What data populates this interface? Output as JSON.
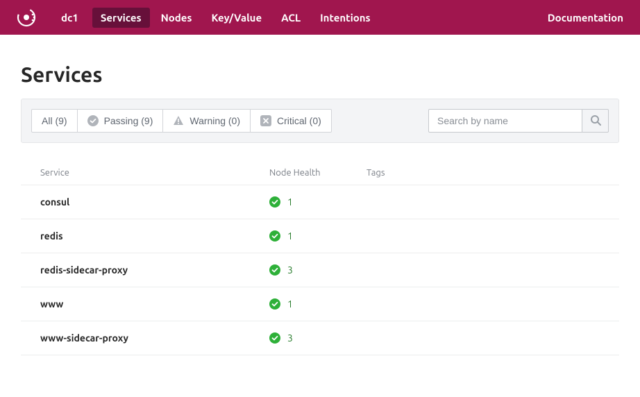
{
  "nav": {
    "datacenter": "dc1",
    "items": [
      {
        "label": "Services",
        "active": true
      },
      {
        "label": "Nodes",
        "active": false
      },
      {
        "label": "Key/Value",
        "active": false
      },
      {
        "label": "ACL",
        "active": false
      },
      {
        "label": "Intentions",
        "active": false
      }
    ],
    "right": "Documentation"
  },
  "page": {
    "title": "Services"
  },
  "filters": {
    "all": "All (9)",
    "passing": "Passing (9)",
    "warning": "Warning (0)",
    "critical": "Critical (0)"
  },
  "search": {
    "placeholder": "Search by name",
    "value": ""
  },
  "table": {
    "headers": {
      "service": "Service",
      "health": "Node Health",
      "tags": "Tags"
    },
    "rows": [
      {
        "name": "consul",
        "health_count": "1",
        "tags": ""
      },
      {
        "name": "redis",
        "health_count": "1",
        "tags": ""
      },
      {
        "name": "redis-sidecar-proxy",
        "health_count": "3",
        "tags": ""
      },
      {
        "name": "www",
        "health_count": "1",
        "tags": ""
      },
      {
        "name": "www-sidecar-proxy",
        "health_count": "3",
        "tags": ""
      }
    ]
  },
  "colors": {
    "brand": "#a0164e",
    "success": "#2eb039"
  }
}
